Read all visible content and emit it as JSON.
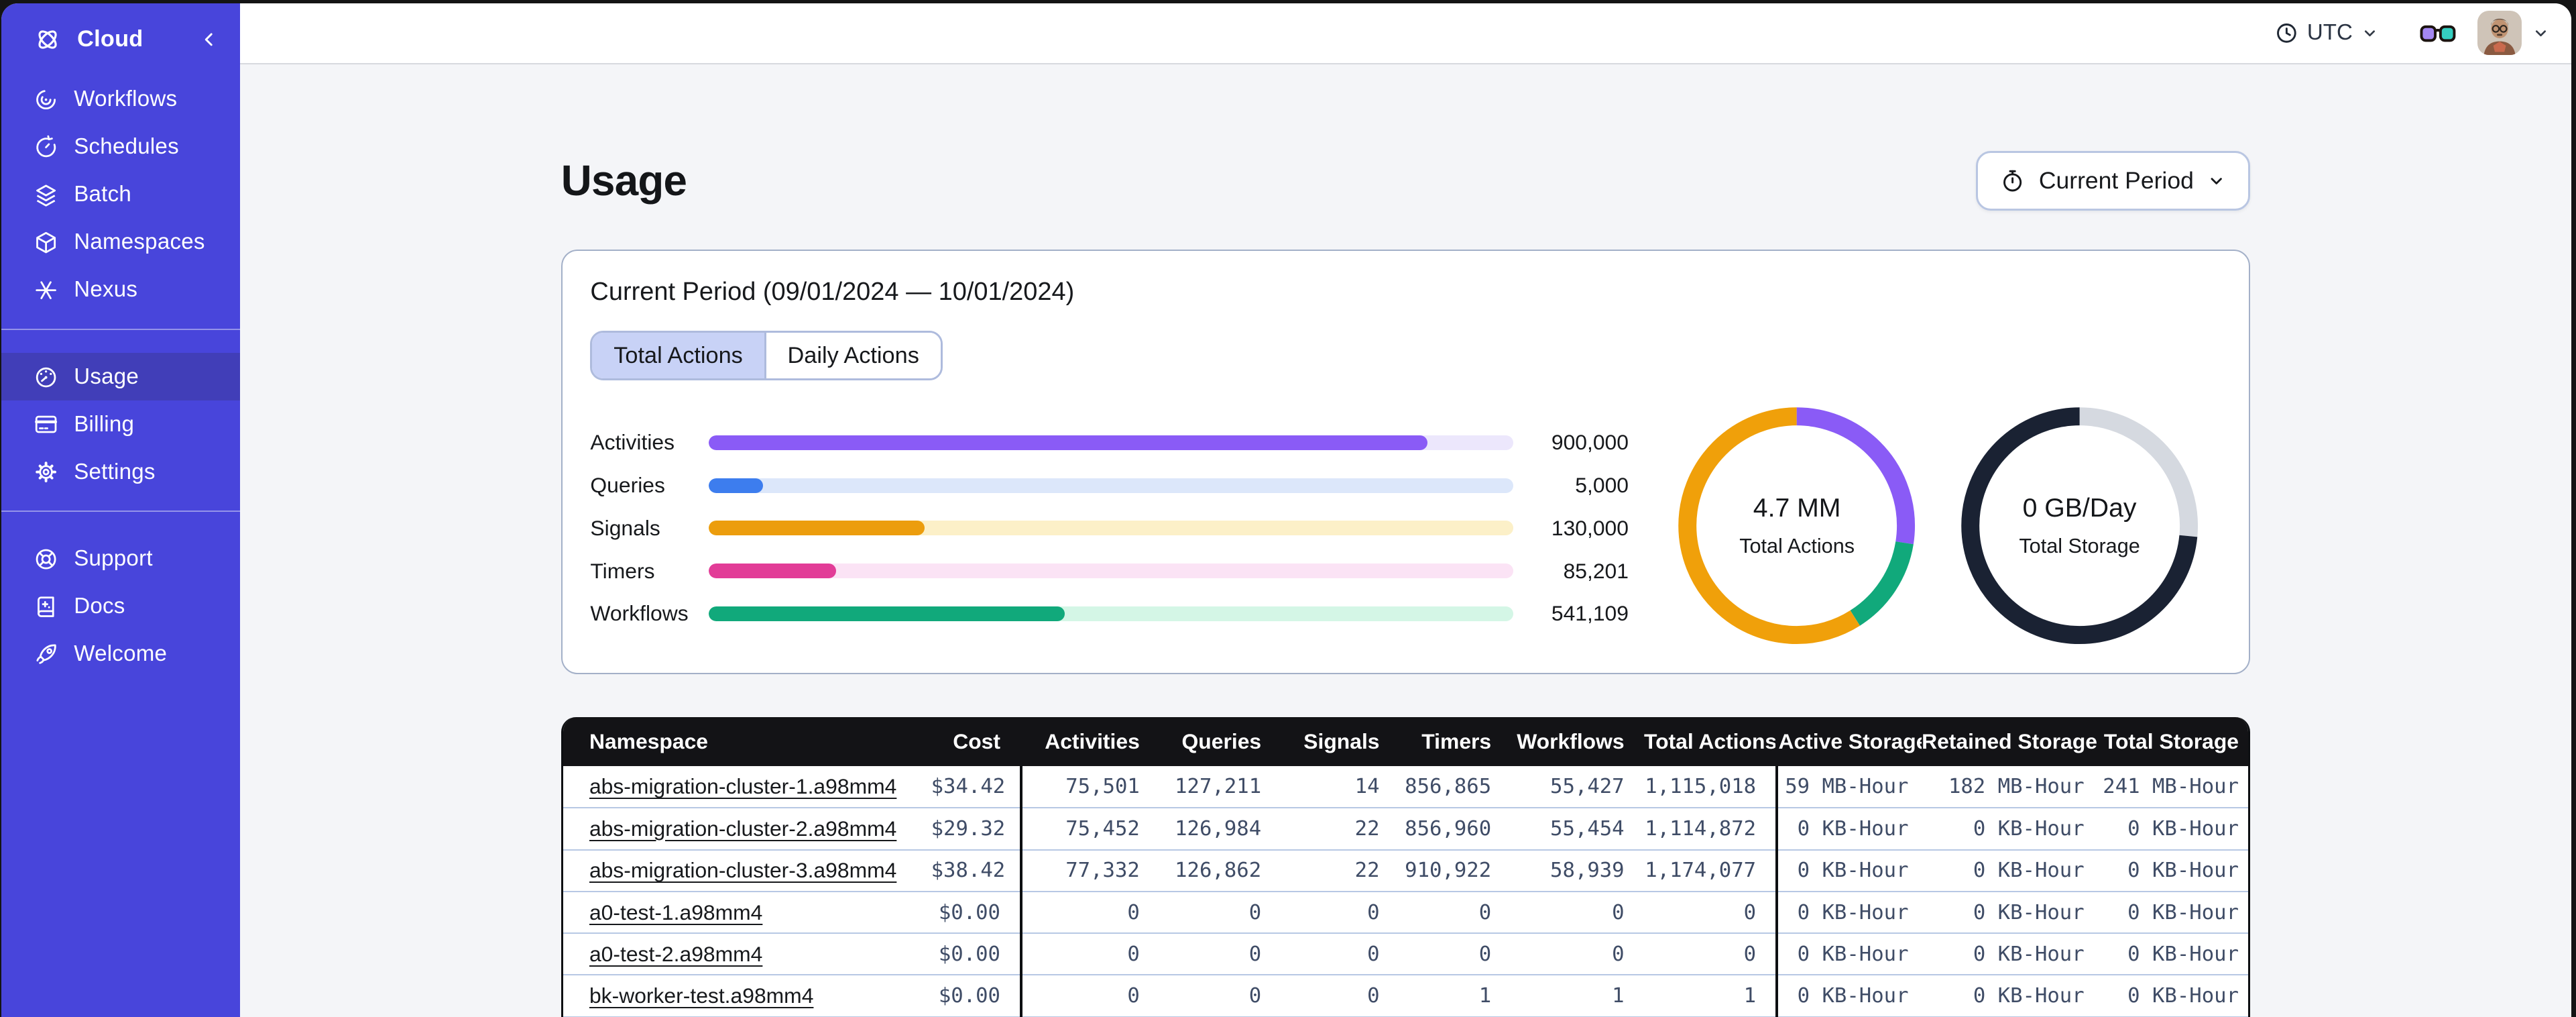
{
  "sidebar": {
    "brand": {
      "label": "Cloud"
    },
    "groups": [
      {
        "items": [
          {
            "icon": "workflows-icon",
            "label": "Workflows"
          },
          {
            "icon": "schedules-icon",
            "label": "Schedules"
          },
          {
            "icon": "batch-icon",
            "label": "Batch"
          },
          {
            "icon": "namespaces-icon",
            "label": "Namespaces"
          },
          {
            "icon": "nexus-icon",
            "label": "Nexus"
          }
        ]
      },
      {
        "items": [
          {
            "icon": "usage-icon",
            "label": "Usage",
            "active": true
          },
          {
            "icon": "billing-icon",
            "label": "Billing"
          },
          {
            "icon": "settings-icon",
            "label": "Settings"
          }
        ]
      },
      {
        "items": [
          {
            "icon": "support-icon",
            "label": "Support"
          },
          {
            "icon": "docs-icon",
            "label": "Docs"
          },
          {
            "icon": "welcome-icon",
            "label": "Welcome"
          }
        ]
      }
    ]
  },
  "topbar": {
    "timezone": "UTC"
  },
  "page": {
    "title": "Usage",
    "period_button": "Current Period"
  },
  "usage_card": {
    "title": "Current Period (09/01/2024 — 10/01/2024)",
    "tabs": [
      {
        "label": "Total Actions",
        "selected": true
      },
      {
        "label": "Daily Actions",
        "selected": false
      }
    ]
  },
  "chart_data": [
    {
      "type": "bar",
      "title": "Current Period (09/01/2024 — 10/01/2024) — Total Actions",
      "orientation": "horizontal",
      "categories": [
        "Activities",
        "Queries",
        "Signals",
        "Timers",
        "Workflows"
      ],
      "values": [
        900000,
        5000,
        130000,
        85201,
        541109
      ],
      "rows": [
        {
          "label": "Activities",
          "value": 900000,
          "value_label": "900,000",
          "pct": 89.3,
          "color": "#8a5bf6",
          "track": "#ece7fc"
        },
        {
          "label": "Queries",
          "value": 5000,
          "value_label": "5,000",
          "pct": 6.8,
          "color": "#3d7dee",
          "track": "#dce7fa"
        },
        {
          "label": "Signals",
          "value": 130000,
          "value_label": "130,000",
          "pct": 26.8,
          "color": "#ec9d0d",
          "track": "#fcf0c8"
        },
        {
          "label": "Timers",
          "value": 85201,
          "value_label": "85,201",
          "pct": 15.8,
          "color": "#e23c97",
          "track": "#fbe3f5"
        },
        {
          "label": "Workflows",
          "value": 541109,
          "value_label": "541,109",
          "pct": 44.2,
          "color": "#11a97b",
          "track": "#d4f6e6"
        }
      ]
    },
    {
      "type": "donut",
      "center_value": "4.7 MM",
      "center_label": "Total Actions",
      "segments": [
        {
          "name": "Activities",
          "color": "#8a5bf6",
          "pct": 27.5
        },
        {
          "name": "Workflows",
          "color": "#11a97b",
          "pct": 13.5
        },
        {
          "name": "Signals",
          "color": "#f0a00a",
          "pct": 59.0
        }
      ]
    },
    {
      "type": "donut",
      "center_value": "0 GB/Day",
      "center_label": "Total Storage",
      "segments": [
        {
          "name": "gray",
          "color": "#d5d9e0",
          "pct": 26.5
        },
        {
          "name": "navy",
          "color": "#1a2233",
          "pct": 73.5
        }
      ]
    }
  ],
  "table": {
    "headers": [
      "Namespace",
      "Cost",
      "Activities",
      "Queries",
      "Signals",
      "Timers",
      "Workflows",
      "Total Actions",
      "Active Storage",
      "Retained Storage",
      "Total Storage"
    ],
    "rows": [
      {
        "namespace": "abs-migration-cluster-1.a98mm4",
        "cost": "$34.42",
        "activities": "75,501",
        "queries": "127,211",
        "signals": "14",
        "timers": "856,865",
        "workflows": "55,427",
        "total_actions": "1,115,018",
        "active_storage": "59 MB-Hour",
        "retained_storage": "182 MB-Hour",
        "total_storage": "241 MB-Hour"
      },
      {
        "namespace": "abs-migration-cluster-2.a98mm4",
        "cost": "$29.32",
        "activities": "75,452",
        "queries": "126,984",
        "signals": "22",
        "timers": "856,960",
        "workflows": "55,454",
        "total_actions": "1,114,872",
        "active_storage": "0 KB-Hour",
        "retained_storage": "0 KB-Hour",
        "total_storage": "0 KB-Hour"
      },
      {
        "namespace": "abs-migration-cluster-3.a98mm4",
        "cost": "$38.42",
        "activities": "77,332",
        "queries": "126,862",
        "signals": "22",
        "timers": "910,922",
        "workflows": "58,939",
        "total_actions": "1,174,077",
        "active_storage": "0 KB-Hour",
        "retained_storage": "0 KB-Hour",
        "total_storage": "0 KB-Hour"
      },
      {
        "namespace": "a0-test-1.a98mm4",
        "cost": "$0.00",
        "activities": "0",
        "queries": "0",
        "signals": "0",
        "timers": "0",
        "workflows": "0",
        "total_actions": "0",
        "active_storage": "0 KB-Hour",
        "retained_storage": "0 KB-Hour",
        "total_storage": "0 KB-Hour"
      },
      {
        "namespace": "a0-test-2.a98mm4",
        "cost": "$0.00",
        "activities": "0",
        "queries": "0",
        "signals": "0",
        "timers": "0",
        "workflows": "0",
        "total_actions": "0",
        "active_storage": "0 KB-Hour",
        "retained_storage": "0 KB-Hour",
        "total_storage": "0 KB-Hour"
      },
      {
        "namespace": "bk-worker-test.a98mm4",
        "cost": "$0.00",
        "activities": "0",
        "queries": "0",
        "signals": "0",
        "timers": "1",
        "workflows": "1",
        "total_actions": "1",
        "active_storage": "0 KB-Hour",
        "retained_storage": "0 KB-Hour",
        "total_storage": "0 KB-Hour"
      }
    ]
  }
}
